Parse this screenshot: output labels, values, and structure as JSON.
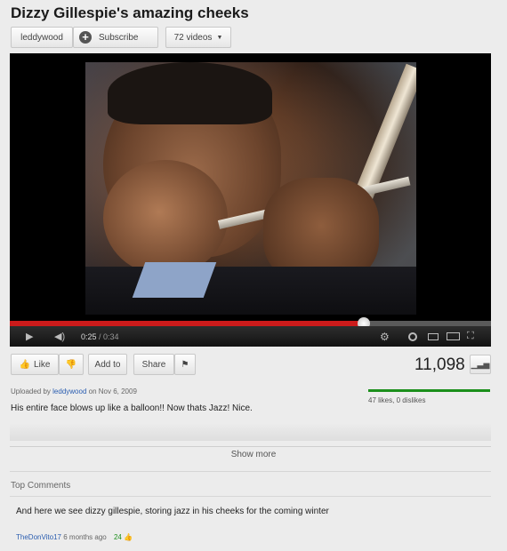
{
  "video": {
    "title": "Dizzy Gillespie's amazing cheeks",
    "channel_label": "leddywood",
    "subscribe_label": "Subscribe",
    "videos_label": "72 videos",
    "progress_fraction": 0.735,
    "time_current": "0:25",
    "time_total": "0:34"
  },
  "actions": {
    "like_label": "Like",
    "add_to_label": "Add to",
    "share_label": "Share"
  },
  "stats": {
    "views": "11,098",
    "likes_dislikes": "47 likes, 0 dislikes",
    "like_ratio": 1.0,
    "ratio_color": "#1b8f1b"
  },
  "description": {
    "uploaded_prefix": "Uploaded by",
    "uploader": "leddywood",
    "uploaded_suffix": "on Nov 6, 2009",
    "text": "His entire face blows up like a balloon!! Now thats Jazz! Nice.",
    "show_more": "Show more"
  },
  "comments": {
    "header": "Top Comments",
    "items": [
      {
        "text": "And here we see dizzy gillespie, storing jazz in his cheeks for the coming winter",
        "user": "TheDonVito17",
        "age": "6 months ago",
        "score": "24"
      }
    ]
  },
  "icons": {
    "like": "thumbs-up-icon",
    "dislike": "thumbs-down-icon",
    "flag": "flag-icon",
    "stats": "stats-icon",
    "play": "play-icon",
    "volume": "volume-icon",
    "settings": "gear-icon"
  },
  "colors": {
    "progress_red": "#cc1b1b",
    "link_blue": "#2a5db0"
  }
}
